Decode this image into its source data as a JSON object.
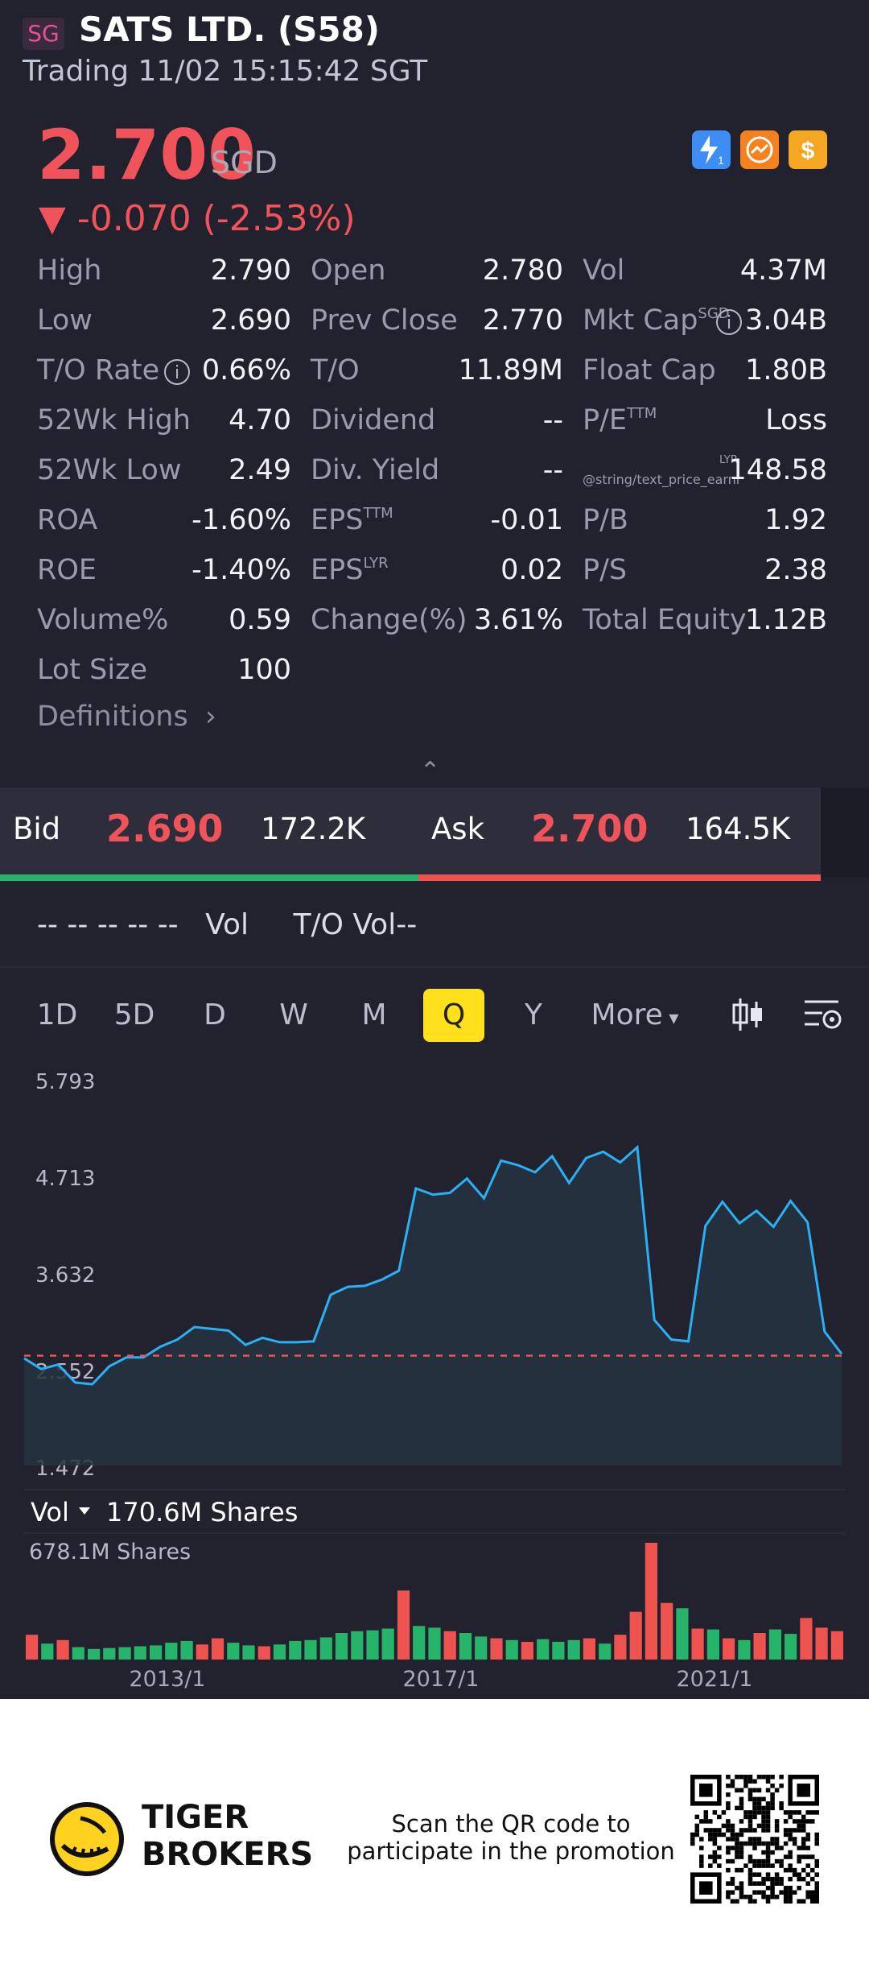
{
  "header": {
    "market_badge": "SG",
    "title": "SATS LTD. (S58)",
    "status": "Trading 11/02 15:15:42 SGT",
    "price": "2.700",
    "currency": "SGD",
    "change": "▼ -0.070 (-2.53%)",
    "badges": [
      "lightning-1-icon",
      "chart-circle-icon",
      "dollar-icon"
    ]
  },
  "stats": {
    "col1": [
      {
        "label": "High",
        "value": "2.790"
      },
      {
        "label": "Low",
        "value": "2.690"
      },
      {
        "label": "T/O Rate",
        "value": "0.66%"
      },
      {
        "label": "52Wk High",
        "value": "4.70"
      },
      {
        "label": "52Wk Low",
        "value": "2.49"
      },
      {
        "label": "ROA",
        "value": "-1.60%"
      },
      {
        "label": "ROE",
        "value": "-1.40%"
      },
      {
        "label": "Volume%",
        "value": "0.59"
      },
      {
        "label": "Lot Size",
        "value": "100"
      }
    ],
    "col2": [
      {
        "label": "Open",
        "value": "2.780"
      },
      {
        "label": "Prev Close",
        "value": "2.770"
      },
      {
        "label": "T/O",
        "value": "11.89M"
      },
      {
        "label": "Dividend",
        "value": "--"
      },
      {
        "label": "Div. Yield",
        "value": "--"
      },
      {
        "label": "EPS",
        "sup": "TTM",
        "value": "-0.01"
      },
      {
        "label": "EPS",
        "sup": "LYR",
        "value": "0.02"
      },
      {
        "label": "Change(%)",
        "value": "3.61%"
      }
    ],
    "col3": [
      {
        "label": "Vol",
        "value": "4.37M"
      },
      {
        "label": "Mkt Cap",
        "sup": "SGD",
        "value": "3.04B"
      },
      {
        "label": "Float Cap",
        "value": "1.80B"
      },
      {
        "label": "P/E",
        "sup": "TTM",
        "value": "Loss"
      },
      {
        "label": "@string/text_price_earni",
        "sup": "LYR",
        "value": "148.58"
      },
      {
        "label": "P/B",
        "value": "1.92"
      },
      {
        "label": "P/S",
        "value": "2.38"
      },
      {
        "label": "Total Equity",
        "value": "1.12B"
      }
    ],
    "info_icon": "i",
    "definitions": "Definitions",
    "chevron": "›",
    "collapse": "⌃"
  },
  "bidask": {
    "bid_label": "Bid",
    "bid_price": "2.690",
    "bid_size": "172.2K",
    "ask_label": "Ask",
    "ask_price": "2.700",
    "ask_size": "164.5K",
    "bid_ratio": 0.51
  },
  "volrow": {
    "dashes": "-- -- -- -- --",
    "vol": "Vol",
    "to_vol": "T/O Vol--"
  },
  "periods": [
    "1D",
    "5D",
    "D",
    "W",
    "M",
    "Q",
    "Y",
    "More"
  ],
  "active_period": "Q",
  "toolbar_icons": [
    "candlestick-icon",
    "chart-settings-icon"
  ],
  "chart_data": [
    {
      "type": "area",
      "ylim": [
        1.472,
        5.793
      ],
      "yticks": [
        "5.793",
        "4.713",
        "3.632",
        "2.552",
        "1.472"
      ],
      "reference_price": 2.7,
      "y": [
        2.67,
        2.55,
        2.6,
        2.4,
        2.38,
        2.58,
        2.68,
        2.68,
        2.8,
        2.88,
        3.02,
        3.0,
        2.98,
        2.82,
        2.9,
        2.85,
        2.85,
        2.86,
        3.38,
        3.47,
        3.48,
        3.55,
        3.65,
        4.57,
        4.5,
        4.52,
        4.68,
        4.46,
        4.88,
        4.83,
        4.75,
        4.93,
        4.63,
        4.91,
        4.98,
        4.86,
        5.03,
        3.1,
        2.88,
        2.86,
        4.15,
        4.42,
        4.18,
        4.32,
        4.14,
        4.43,
        4.19,
        2.97,
        2.72
      ]
    },
    {
      "type": "bar",
      "label": "Vol",
      "current_volume": "170.6M Shares",
      "max_label": "678.1M Shares",
      "xticks": [
        "2013/1",
        "2017/1",
        "2021/1"
      ],
      "values": [
        140,
        90,
        110,
        70,
        60,
        65,
        70,
        75,
        80,
        95,
        105,
        85,
        120,
        95,
        80,
        75,
        85,
        105,
        110,
        125,
        150,
        160,
        165,
        175,
        390,
        190,
        180,
        160,
        150,
        130,
        120,
        110,
        100,
        115,
        100,
        110,
        120,
        90,
        140,
        270,
        660,
        320,
        290,
        175,
        170,
        120,
        110,
        150,
        170,
        145,
        235,
        180,
        160
      ],
      "up": [
        false,
        true,
        false,
        true,
        true,
        true,
        true,
        true,
        true,
        true,
        true,
        false,
        false,
        true,
        true,
        false,
        true,
        true,
        true,
        true,
        true,
        true,
        true,
        true,
        false,
        true,
        true,
        false,
        true,
        true,
        false,
        true,
        false,
        true,
        true,
        true,
        false,
        true,
        false,
        false,
        false,
        false,
        true,
        false,
        true,
        false,
        true,
        false,
        true,
        true,
        false,
        false,
        false
      ]
    }
  ],
  "promo": {
    "brand_line1": "TIGER",
    "brand_line2": "BROKERS",
    "text": "Scan the QR code to participate in the promotion"
  }
}
